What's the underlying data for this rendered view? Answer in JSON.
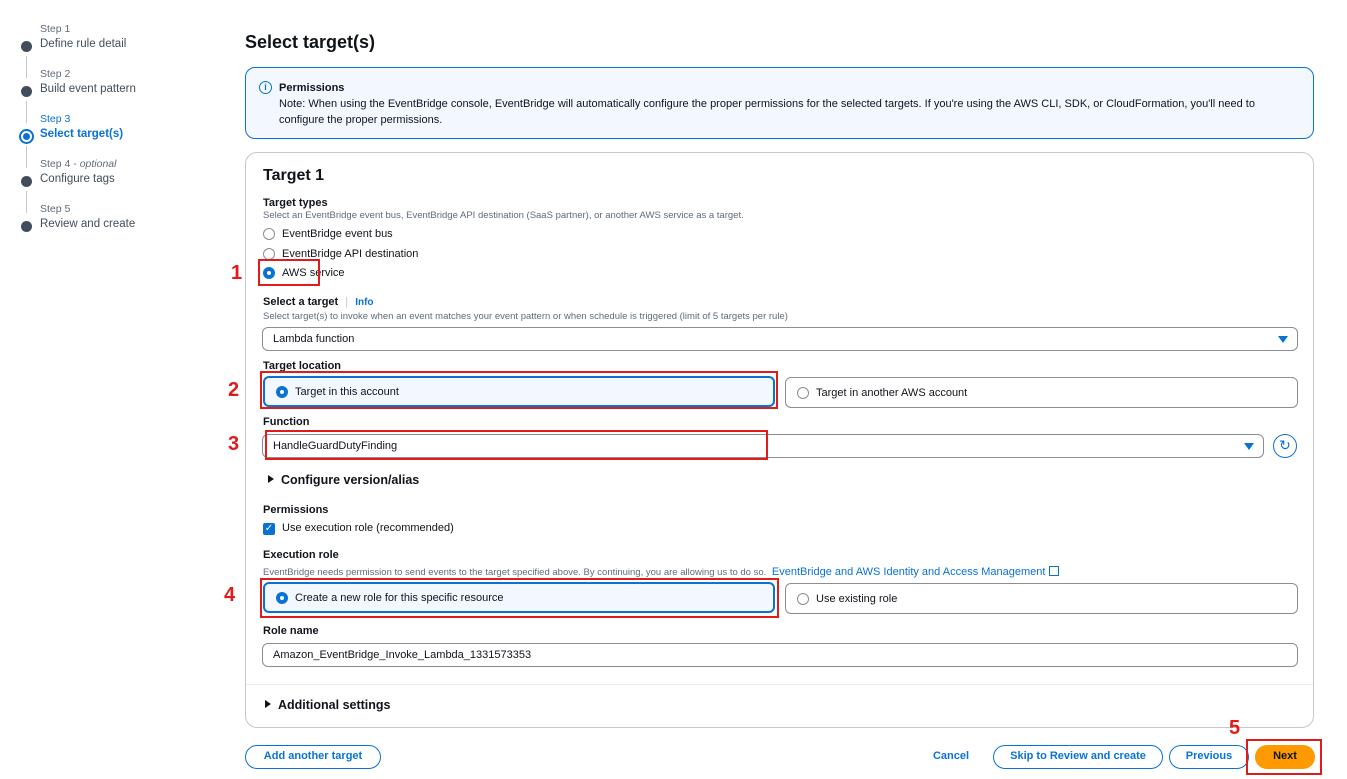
{
  "steps": [
    {
      "sub": "Step 1",
      "label": "Define rule detail"
    },
    {
      "sub": "Step 2",
      "label": "Build event pattern"
    },
    {
      "sub": "Step 3",
      "label": "Select target(s)"
    },
    {
      "sub": "Step 4",
      "sub_optional": "optional",
      "label": "Configure tags"
    },
    {
      "sub": "Step 5",
      "label": "Review and create"
    }
  ],
  "page_title": "Select target(s)",
  "alert": {
    "title": "Permissions",
    "text": "Note: When using the EventBridge console, EventBridge will automatically configure the proper permissions for the selected targets. If you're using the AWS CLI, SDK, or CloudFormation, you'll need to configure the proper permissions."
  },
  "target": {
    "title": "Target 1",
    "types_label": "Target types",
    "types_desc": "Select an EventBridge event bus, EventBridge API destination (SaaS partner), or another AWS service as a target.",
    "types": [
      "EventBridge event bus",
      "EventBridge API destination",
      "AWS service"
    ],
    "selected_type": "AWS service",
    "select_target_label": "Select a target",
    "info_link": "Info",
    "select_target_desc": "Select target(s) to invoke when an event matches your event pattern or when schedule is triggered (limit of 5 targets per rule)",
    "select_target_value": "Lambda function",
    "location_label": "Target location",
    "location_options": [
      "Target in this account",
      "Target in another AWS account"
    ],
    "function_label": "Function",
    "function_value": "HandleGuardDutyFinding",
    "configure_version": "Configure version/alias",
    "permissions_label": "Permissions",
    "use_exec_role": "Use execution role (recommended)",
    "exec_role_label": "Execution role",
    "exec_role_desc": "EventBridge needs permission to send events to the target specified above. By continuing, you are allowing us to do so.",
    "exec_role_link": "EventBridge and AWS Identity and Access Management",
    "role_options": [
      "Create a new role for this specific resource",
      "Use existing role"
    ],
    "role_name_label": "Role name",
    "role_name_value": "Amazon_EventBridge_Invoke_Lambda_1331573353",
    "additional_settings": "Additional settings"
  },
  "footer": {
    "add_target": "Add another target",
    "cancel": "Cancel",
    "skip": "Skip to Review and create",
    "previous": "Previous",
    "next": "Next"
  },
  "annotations": [
    "1",
    "2",
    "3",
    "4",
    "5"
  ],
  "colors": {
    "accent": "#0972d3",
    "primary_button": "#ff9900",
    "annotation": "#e01b1b"
  }
}
